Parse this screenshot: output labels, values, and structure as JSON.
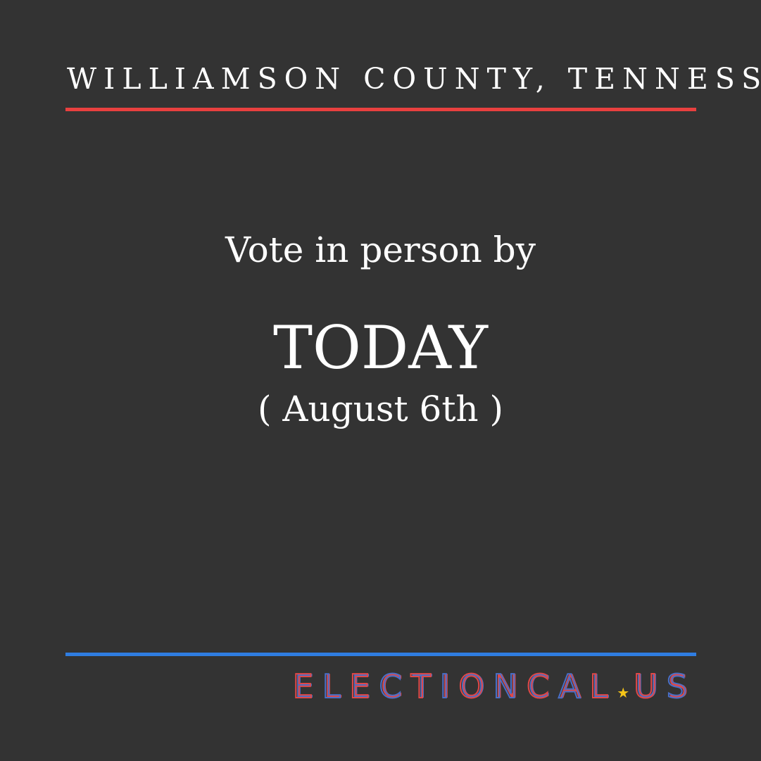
{
  "header": {
    "title": "WILLIAMSON COUNTY, TENNESS"
  },
  "message": {
    "intro": "Vote in person by",
    "deadline": "TODAY",
    "date": "( August 6th )"
  },
  "logo": {
    "text_before": "ELECTIONCAL",
    "text_after": "US",
    "star_glyph": "★",
    "star_icon": "star-icon"
  },
  "colors": {
    "background": "#333333",
    "text": "#ffffff",
    "accent_red": "#e8403f",
    "accent_blue": "#2f7de1",
    "logo_red": "#e04848",
    "logo_blue": "#4a6fc8",
    "star_yellow": "#f5c518"
  }
}
